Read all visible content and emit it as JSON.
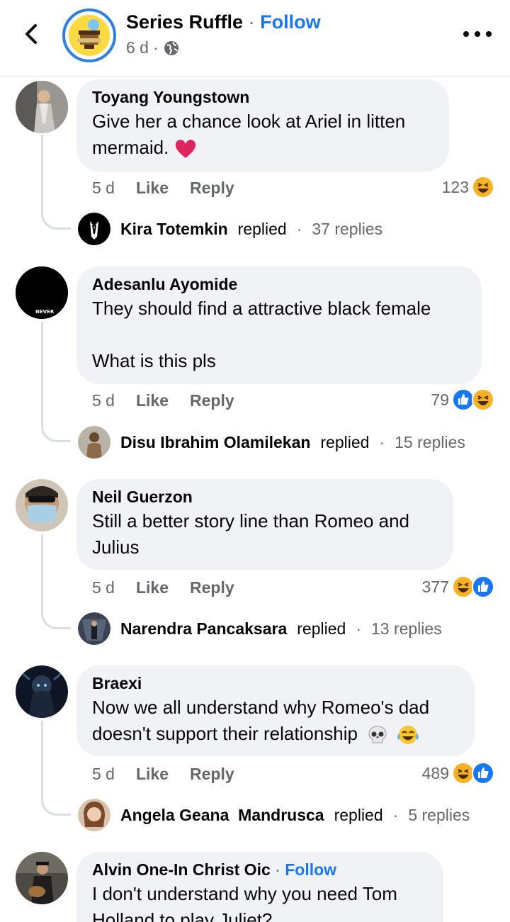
{
  "header": {
    "page_name": "Series Ruffle",
    "separator": "·",
    "follow": "Follow",
    "time": "6 d",
    "meta_sep": "·",
    "icons": {
      "back": "chevron-left-icon",
      "privacy": "globe-icon",
      "more": "more-dots-icon"
    }
  },
  "comments": [
    {
      "author": "Toyang Youngstown",
      "text": "Give her a chance look at Ariel in litten mermaid.",
      "emoji": "red-heart",
      "time": "5 d",
      "like": "Like",
      "reply": "Reply",
      "reaction_count": "123",
      "reactions": [
        "haha"
      ],
      "replier": "Kira Totemkin",
      "replied_word": "replied",
      "reply_sep": "·",
      "reply_count": "37 replies"
    },
    {
      "author": "Adesanlu Ayomide",
      "text": "They should find a attractive black female",
      "text2": "What is this pls",
      "avatar_text": "NEVER",
      "time": "5 d",
      "like": "Like",
      "reply": "Reply",
      "reaction_count": "79",
      "reactions": [
        "like",
        "haha"
      ],
      "replier": "Disu Ibrahim Olamilekan",
      "replied_word": "replied",
      "reply_sep": "·",
      "reply_count": "15 replies"
    },
    {
      "author": "Neil Guerzon",
      "text": "Still a better story line than Romeo and Julius",
      "time": "5 d",
      "like": "Like",
      "reply": "Reply",
      "reaction_count": "377",
      "reactions": [
        "haha",
        "like"
      ],
      "replier": "Narendra Pancaksara",
      "replied_word": "replied",
      "reply_sep": "·",
      "reply_count": "13 replies"
    },
    {
      "author": "Braexi",
      "text": "Now we all understand why Romeo's dad doesn't support their relationship",
      "emoji": "skull, tears-of-joy",
      "time": "5 d",
      "like": "Like",
      "reply": "Reply",
      "reaction_count": "489",
      "reactions": [
        "haha",
        "like"
      ],
      "replier": "Angela Geana  Mandrusca",
      "replied_word": "replied",
      "reply_sep": "·",
      "reply_count": "5 replies"
    },
    {
      "author": "Alvin One-In Christ Oic",
      "author_sep": "·",
      "author_follow": "Follow",
      "text": "I don't understand why you need Tom Holland to play Juliet?"
    }
  ],
  "colors": {
    "link": "#1877f2",
    "bubble": "#f0f2f5",
    "muted": "#65676b",
    "like": "#1877f2",
    "haha": "#f7b125",
    "heart": "#e0245e"
  }
}
